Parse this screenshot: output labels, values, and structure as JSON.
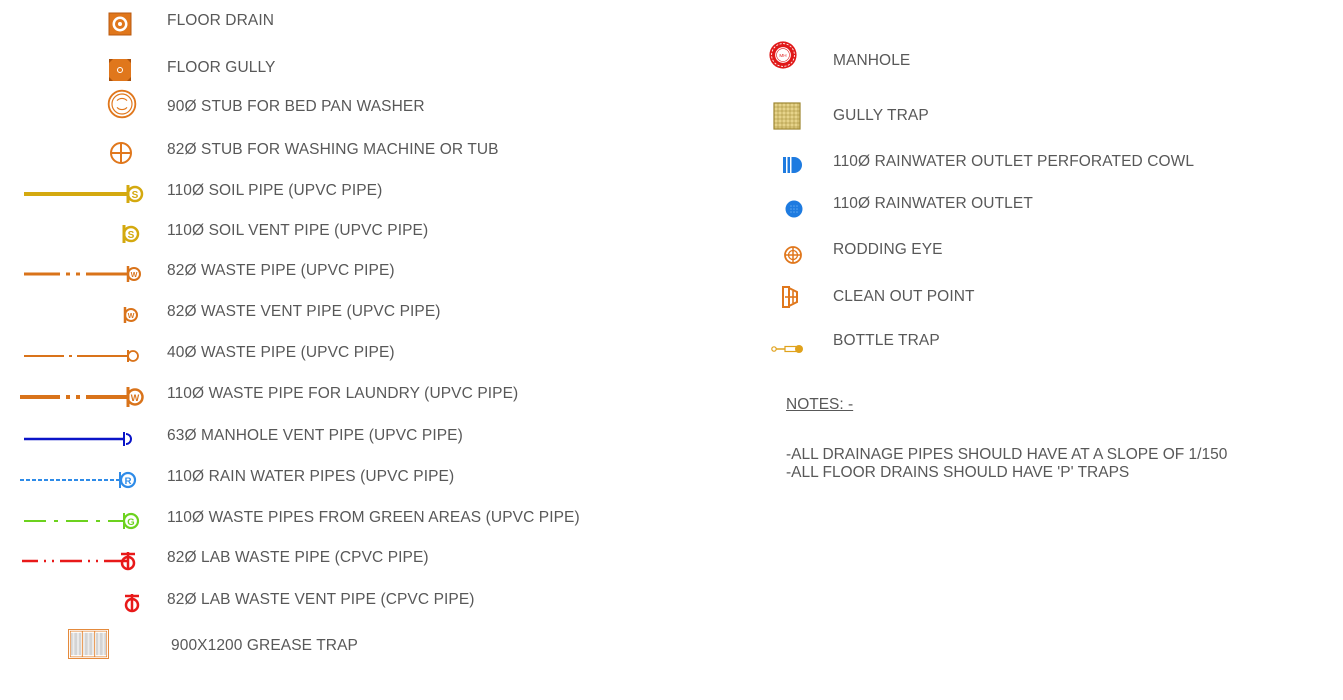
{
  "legend_left": [
    {
      "id": "floor-drain",
      "symbol": "floor-drain-icon",
      "label": "FLOOR DRAIN",
      "color": "#E0771C"
    },
    {
      "id": "floor-gully",
      "symbol": "floor-gully-icon",
      "label": "FLOOR GULLY",
      "color": "#E0771C"
    },
    {
      "id": "bed-pan-stub",
      "symbol": "bed-pan-stub-icon",
      "label": "90Ø STUB FOR BED PAN WASHER",
      "color": "#E0771C"
    },
    {
      "id": "washing-machine-stub",
      "symbol": "washing-machine-stub-icon",
      "label": "82Ø STUB FOR WASHING MACHINE OR TUB",
      "color": "#E0771C"
    },
    {
      "id": "soil-pipe",
      "symbol": "soil-pipe-line-icon",
      "label": "110Ø SOIL PIPE (UPVC PIPE)",
      "color": "#D4A90F"
    },
    {
      "id": "soil-vent-pipe",
      "symbol": "soil-vent-icon",
      "label": "110Ø SOIL VENT PIPE (UPVC PIPE)",
      "color": "#D4A90F"
    },
    {
      "id": "waste-pipe-82",
      "symbol": "waste-pipe-line-icon",
      "label": "82Ø WASTE PIPE (UPVC PIPE)",
      "color": "#D9731A"
    },
    {
      "id": "waste-vent-pipe-82",
      "symbol": "waste-vent-icon",
      "label": "82Ø WASTE VENT PIPE (UPVC PIPE)",
      "color": "#D9731A"
    },
    {
      "id": "waste-pipe-40",
      "symbol": "waste-pipe-40-line-icon",
      "label": "40Ø WASTE PIPE (UPVC PIPE)",
      "color": "#D9731A"
    },
    {
      "id": "laundry-waste-pipe",
      "symbol": "laundry-pipe-line-icon",
      "label": "110Ø WASTE PIPE FOR LAUNDRY (UPVC PIPE)",
      "color": "#D9731A"
    },
    {
      "id": "manhole-vent-pipe",
      "symbol": "manhole-vent-line-icon",
      "label": "63Ø MANHOLE VENT PIPE (UPVC PIPE)",
      "color": "#0A14C8"
    },
    {
      "id": "rain-water-pipe",
      "symbol": "rain-water-line-icon",
      "label": "110Ø RAIN WATER PIPES (UPVC PIPE)",
      "color": "#2E8BE8"
    },
    {
      "id": "green-area-pipe",
      "symbol": "green-area-line-icon",
      "label": "110Ø WASTE PIPES FROM GREEN AREAS (UPVC PIPE)",
      "color": "#6CD21E"
    },
    {
      "id": "lab-waste-pipe",
      "symbol": "lab-waste-line-icon",
      "label": "82Ø LAB WASTE PIPE (CPVC PIPE)",
      "color": "#E81919"
    },
    {
      "id": "lab-waste-vent",
      "symbol": "lab-waste-vent-icon",
      "label": "82Ø LAB WASTE VENT PIPE (CPVC PIPE)",
      "color": "#E81919"
    },
    {
      "id": "grease-trap",
      "symbol": "grease-trap-icon",
      "label": "900X1200 GREASE TRAP",
      "color": "#E0771C"
    }
  ],
  "legend_right": [
    {
      "id": "manhole",
      "symbol": "manhole-icon",
      "label": "MANHOLE",
      "color": "#E01818",
      "badge": "MH"
    },
    {
      "id": "gully-trap",
      "symbol": "gully-trap-icon",
      "label": "GULLY TRAP",
      "color": "#B59A3A"
    },
    {
      "id": "rw-outlet-cowl",
      "symbol": "rw-cowl-icon",
      "label": "110Ø RAINWATER OUTLET PERFORATED COWL",
      "color": "#1E7BE0"
    },
    {
      "id": "rw-outlet",
      "symbol": "rw-outlet-icon",
      "label": "110Ø RAINWATER OUTLET",
      "color": "#1E7BE0"
    },
    {
      "id": "rodding-eye",
      "symbol": "rodding-eye-icon",
      "label": "RODDING EYE",
      "color": "#E0771C"
    },
    {
      "id": "clean-out-point",
      "symbol": "clean-out-icon",
      "label": "CLEAN OUT POINT",
      "color": "#E0771C"
    },
    {
      "id": "bottle-trap",
      "symbol": "bottle-trap-icon",
      "label": "BOTTLE TRAP",
      "color": "#E0A21C"
    }
  ],
  "pipe_letters": {
    "soil": "S",
    "waste": "W",
    "rain": "R",
    "green": "G"
  },
  "notes": {
    "title": "NOTES: -",
    "lines": [
      "-ALL DRAINAGE PIPES SHOULD HAVE AT A SLOPE OF 1/150",
      "-ALL FLOOR DRAINS SHOULD HAVE 'P' TRAPS"
    ]
  }
}
